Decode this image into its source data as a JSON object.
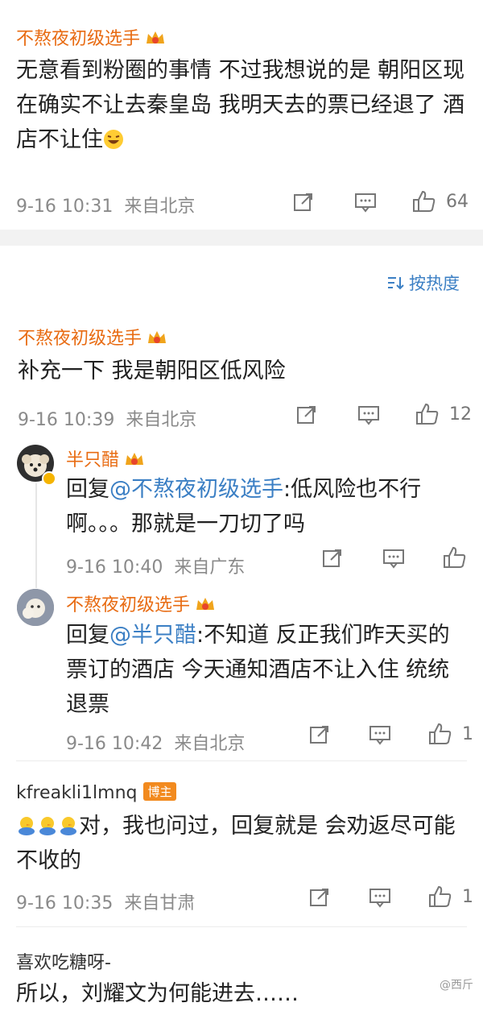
{
  "top_comment": {
    "username": "不熬夜初级选手",
    "text": "无意看到粉圈的事情 不过我想说的是 朝阳区现在确实不让去秦皇岛 我明天去的票已经退了 酒店不让住",
    "time": "9-16 10:31",
    "source": "来自北京",
    "likes": "64"
  },
  "sort": {
    "label": "按热度"
  },
  "thread": {
    "main": {
      "username": "不熬夜初级选手",
      "text": "补充一下 我是朝阳区低风险",
      "time": "9-16 10:39",
      "source": "来自北京",
      "likes": "12"
    },
    "reply1": {
      "username": "半只醋",
      "prefix": "回复",
      "mention": "@不熬夜初级选手",
      "text": ":低风险也不行啊。。。那就是一刀切了吗",
      "time": "9-16 10:40",
      "source": "来自广东"
    },
    "reply2": {
      "username": "不熬夜初级选手",
      "prefix": "回复",
      "mention": "@半只醋",
      "text": ":不知道 反正我们昨天买的票订的酒店 今天通知酒店不让入住 统统退票",
      "time": "9-16 10:42",
      "source": "来自北京",
      "likes": "1"
    }
  },
  "comment3": {
    "username": "kfreakli1lmnq",
    "badge": "博主",
    "text": "对，我也问过，回复就是 会劝返尽可能不收的",
    "time": "9-16 10:35",
    "source": "来自甘肃",
    "likes": "1"
  },
  "comment4": {
    "username": "喜欢吃糖呀-",
    "text": "所以，刘耀文为何能进去……"
  },
  "watermark": "@西斤",
  "colors": {
    "accent": "#e86b12",
    "link": "#3b7fc4",
    "divider": "#f2f2f2"
  }
}
